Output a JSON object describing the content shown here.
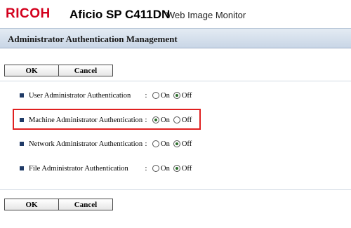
{
  "header": {
    "logo": "RICOH",
    "model": "Aficio SP C411DN",
    "subtitle": "Web Image Monitor"
  },
  "page": {
    "title": "Administrator Authentication Management"
  },
  "buttons": {
    "ok_label": "OK",
    "cancel_label": "Cancel"
  },
  "settings": [
    {
      "label": "User Administrator Authentication",
      "colon": ":",
      "on_label": "On",
      "off_label": "Off",
      "selected": "Off"
    },
    {
      "label": "Machine Administrator Authentication",
      "colon": ":",
      "on_label": "On",
      "off_label": "Off",
      "selected": "On"
    },
    {
      "label": "Network Administrator Authentication",
      "colon": ":",
      "on_label": "On",
      "off_label": "Off",
      "selected": "Off"
    },
    {
      "label": "File Administrator Authentication",
      "colon": ":",
      "on_label": "On",
      "off_label": "Off",
      "selected": "Off"
    }
  ],
  "colors": {
    "brand_red": "#d3001d",
    "highlight": "#e02020",
    "bullet": "#1f3a66"
  }
}
